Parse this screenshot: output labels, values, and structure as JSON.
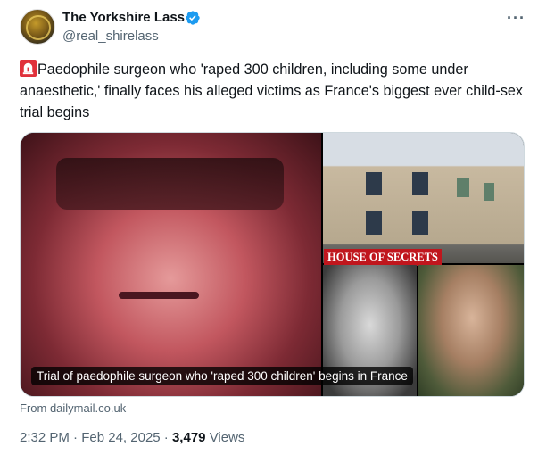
{
  "author": {
    "name": "The Yorkshire Lass",
    "handle": "@real_shirelass",
    "verified_color": "#1d9bf0"
  },
  "more_icon": "more-horizontal-icon",
  "tweet_text": "Paedophile surgeon who 'raped 300 children, including some under anaesthetic,' finally faces his alleged victims as France's biggest ever child-sex trial begins",
  "link_card": {
    "image_caption": "Trial of paedophile surgeon who 'raped 300 children' begins in France",
    "house_label": "HOUSE OF SECRETS",
    "source": "From dailymail.co.uk"
  },
  "footer": {
    "time": "2:32 PM",
    "separator1": "·",
    "date": "Feb 24, 2025",
    "separator2": "·",
    "views_count": "3,479",
    "views_label": "Views"
  },
  "colors": {
    "text_primary": "#0f1419",
    "text_secondary": "#536471",
    "border": "#cfd9de",
    "label_red": "#c0161d"
  }
}
